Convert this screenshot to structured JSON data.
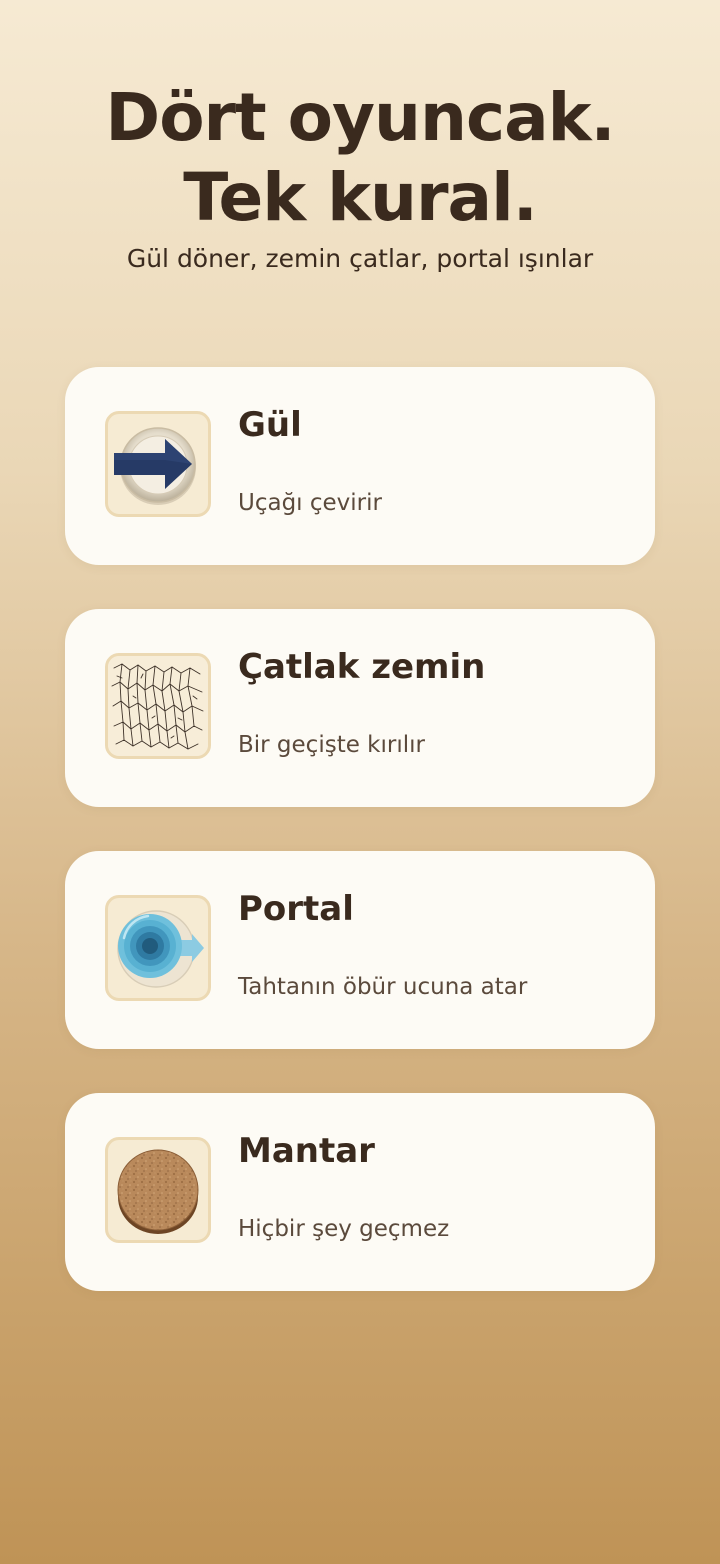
{
  "hero": {
    "title_line1": "Dört oyuncak.",
    "title_line2": "Tek kural.",
    "subtitle": "Gül döner, zemin çatlar, portal ışınlar"
  },
  "cards": [
    {
      "title": "Gül",
      "description": "Uçağı çevirir",
      "icon": "compass-arrow-icon"
    },
    {
      "title": "Çatlak zemin",
      "description": "Bir geçişte kırılır",
      "icon": "cracked-floor-icon"
    },
    {
      "title": "Portal",
      "description": "Tahtanın öbür ucuna atar",
      "icon": "portal-icon"
    },
    {
      "title": "Mantar",
      "description": "Hiçbir şey geçmez",
      "icon": "cork-icon"
    }
  ],
  "colors": {
    "text": "#3a2a1e",
    "card_background": "#fdfbf5",
    "tile_background": "#f6ebd3",
    "arrow": "#263a66",
    "portal": "#5cb4d4",
    "cork": "#b88a5d"
  }
}
